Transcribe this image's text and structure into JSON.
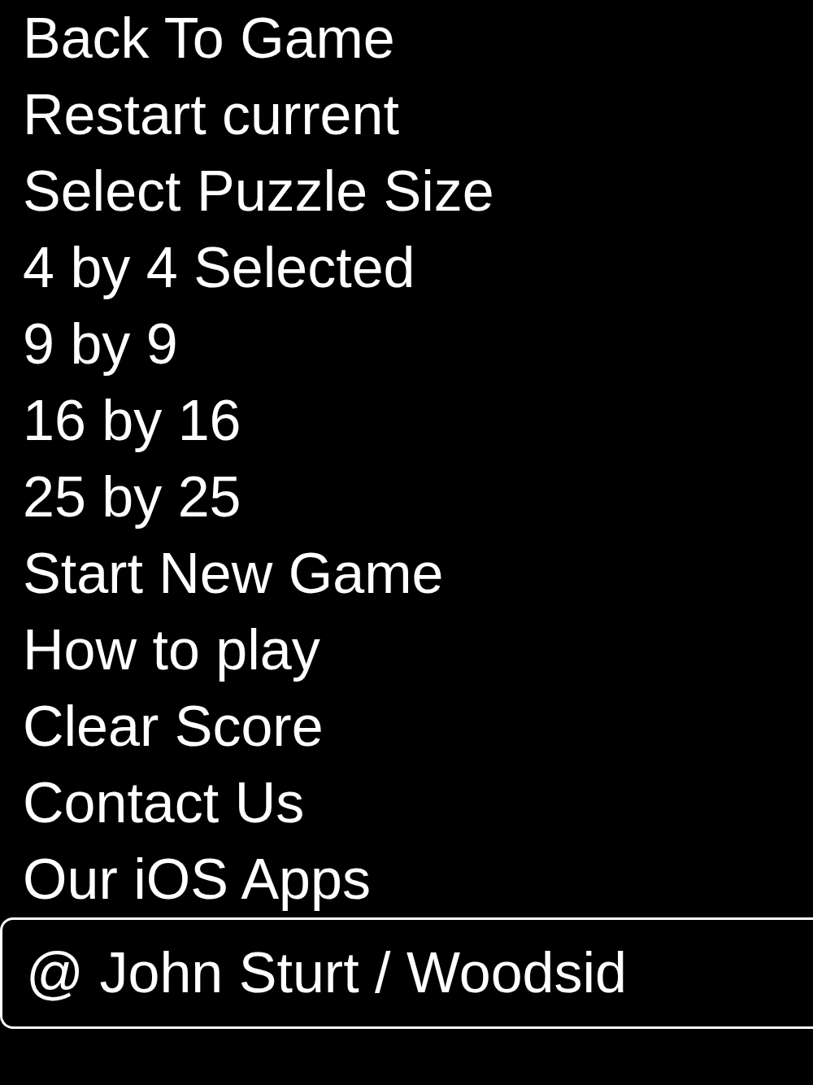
{
  "menu": {
    "items": [
      {
        "label": "Back To Game"
      },
      {
        "label": "Restart current"
      },
      {
        "label": "Select Puzzle Size"
      },
      {
        "label": "4 by 4 Selected"
      },
      {
        "label": "9 by 9"
      },
      {
        "label": "16 by 16"
      },
      {
        "label": "25 by 25"
      },
      {
        "label": "Start New Game"
      },
      {
        "label": "How to play"
      },
      {
        "label": "Clear Score"
      },
      {
        "label": "Contact Us"
      },
      {
        "label": "Our iOS Apps"
      }
    ]
  },
  "footer": {
    "text": "@ John Sturt / Woodsid"
  }
}
